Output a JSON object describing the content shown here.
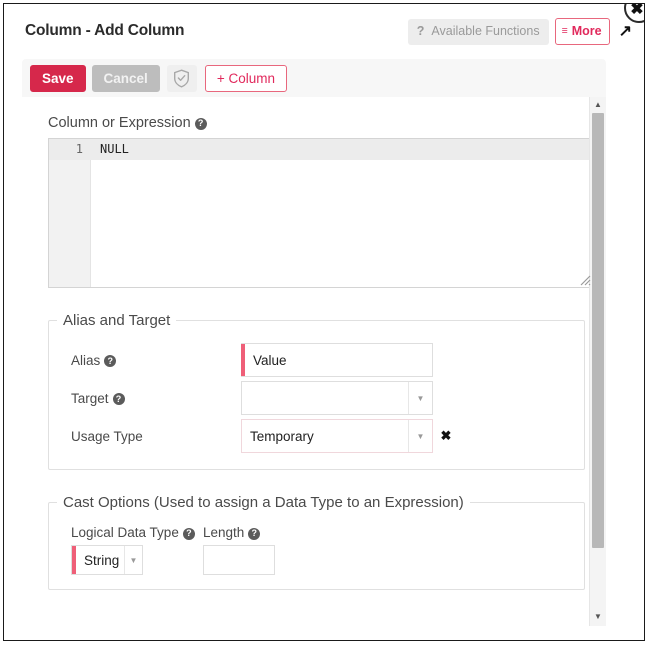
{
  "dialog": {
    "title": "Column - Add Column",
    "header": {
      "available_functions_help": "?",
      "available_functions_label": "Available Functions",
      "more_hamburger": "≡",
      "more_label": "More",
      "expand_icon": "↗",
      "close_icon": "✖"
    },
    "toolbar": {
      "save_label": "Save",
      "cancel_label": "Cancel",
      "validate_icon": "shield-check-icon",
      "add_column_label": "+ Column"
    },
    "editor": {
      "label": "Column or Expression",
      "help": "?",
      "line_number": "1",
      "code": "NULL"
    },
    "alias_and_target": {
      "legend": "Alias and Target",
      "alias": {
        "label": "Alias",
        "help": "?",
        "value": "Value"
      },
      "target": {
        "label": "Target",
        "help": "?",
        "value": "",
        "caret": "▼"
      },
      "usage_type": {
        "label": "Usage Type",
        "value": "Temporary",
        "caret": "▼",
        "clear_icon": "✖"
      }
    },
    "cast_options": {
      "legend": "Cast Options (Used to assign a Data Type to an Expression)",
      "logical_data_type": {
        "label": "Logical Data Type",
        "help": "?",
        "value": "String",
        "caret": "▼"
      },
      "length": {
        "label": "Length",
        "help": "?",
        "value": ""
      }
    },
    "scrollbar": {
      "up_arrow": "▲",
      "down_arrow": "▼"
    },
    "colors": {
      "accent_red": "#d6284b",
      "accent_pink": "#e1295c",
      "required_bar": "#ef5f78",
      "cancel_gray": "#bdbdbd"
    }
  }
}
